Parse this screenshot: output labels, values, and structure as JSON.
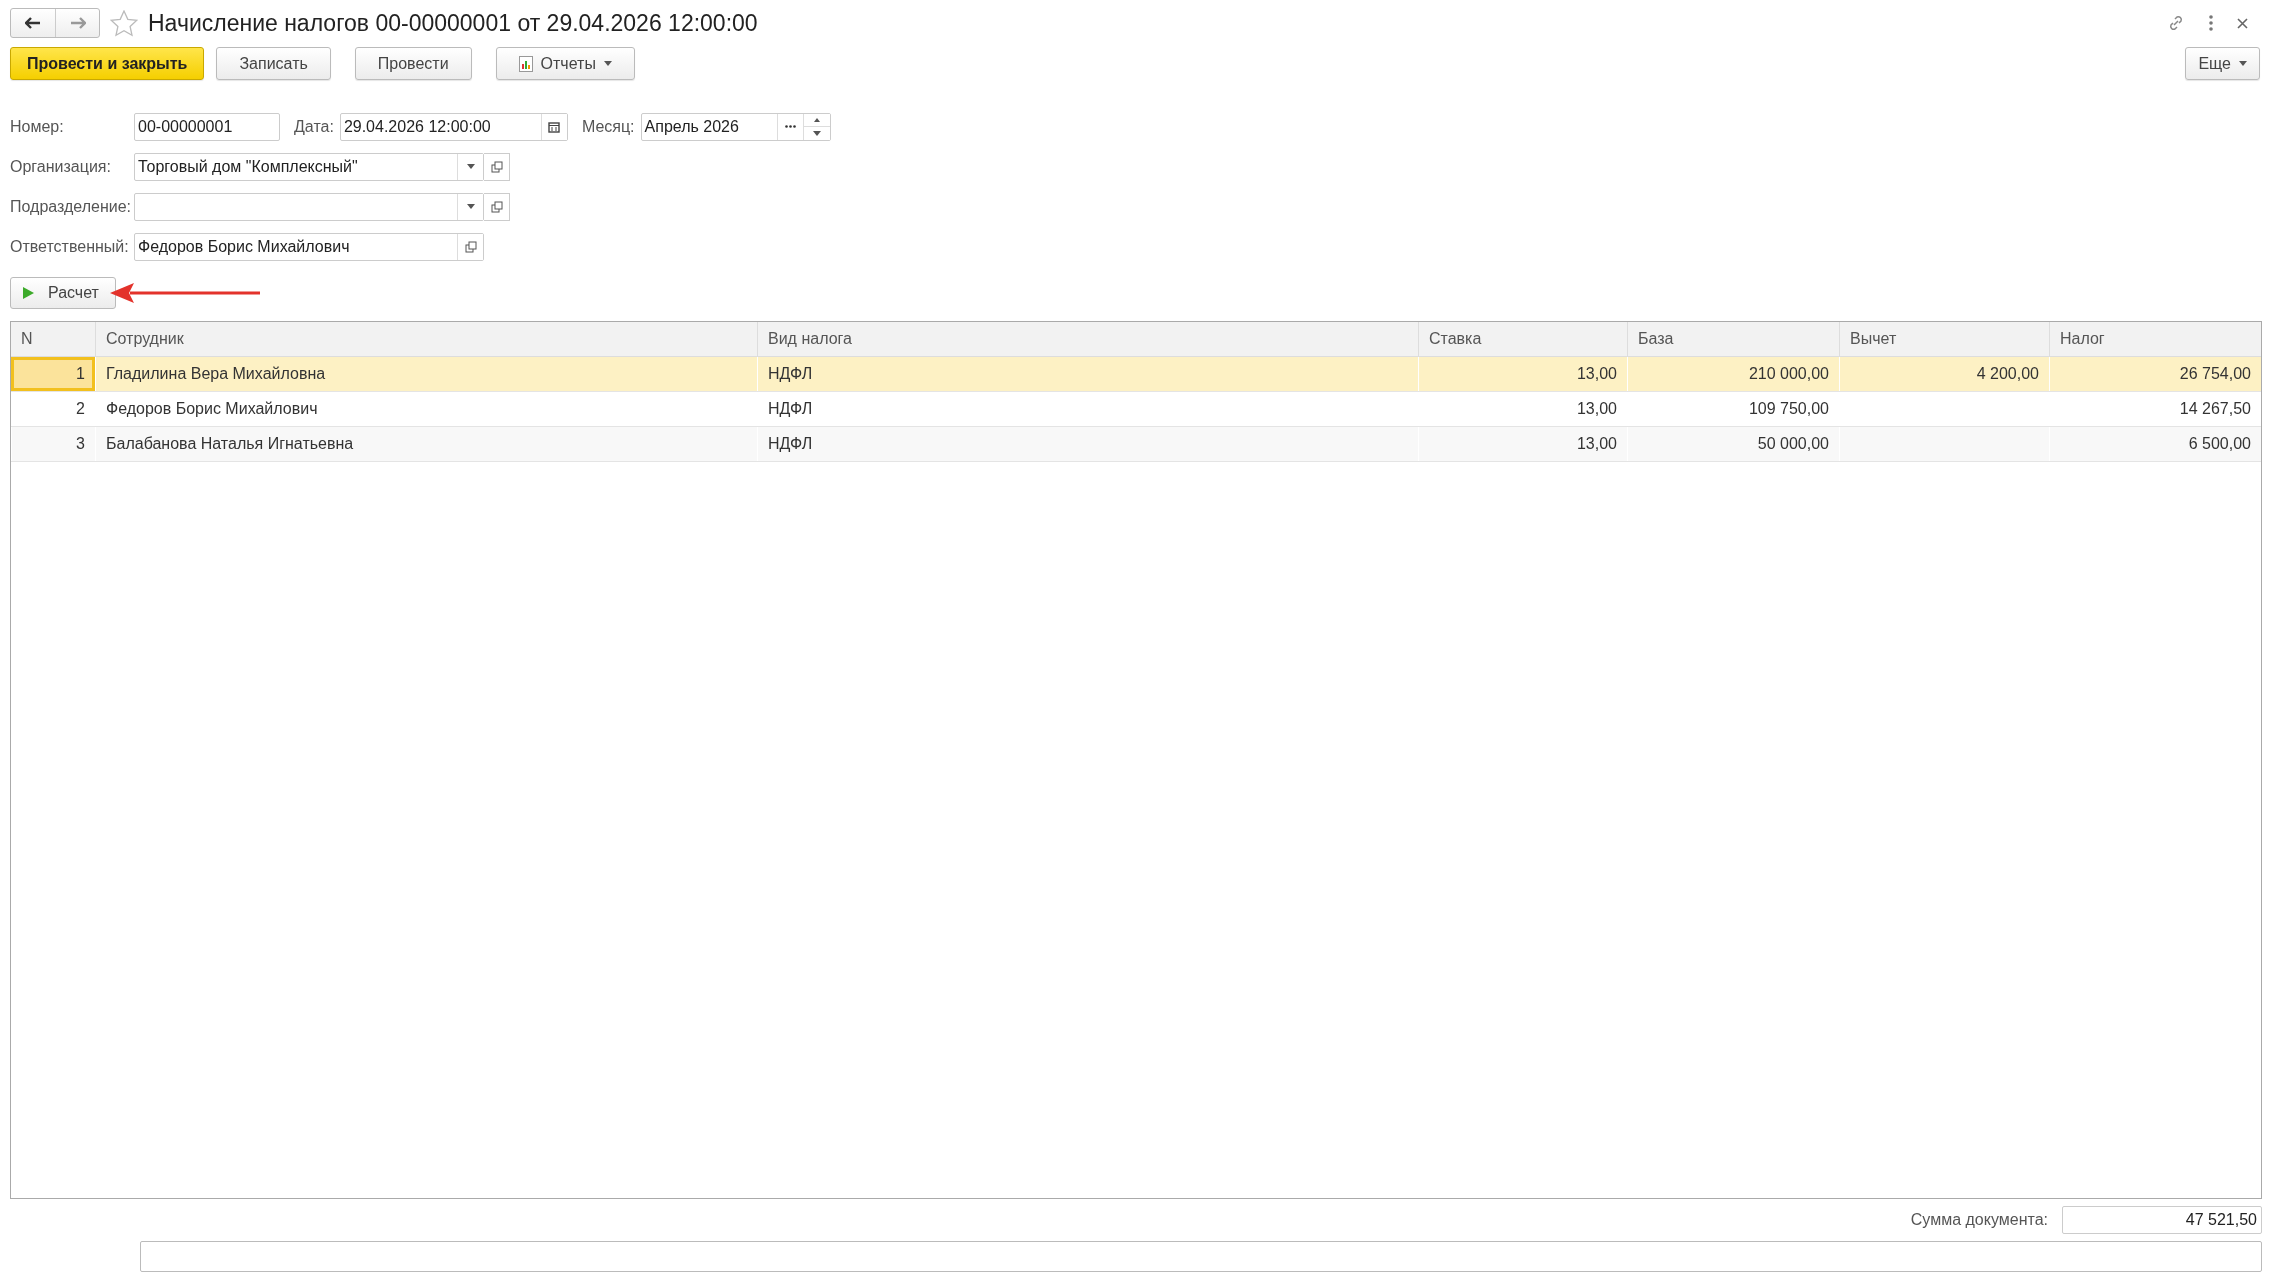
{
  "window": {
    "title": "Начисление налогов 00-00000001 от 29.04.2026 12:00:00"
  },
  "toolbar": {
    "buttons": [
      {
        "label": "Провести и закрыть",
        "kind": "primary"
      },
      {
        "label": "Записать",
        "kind": "plain"
      },
      {
        "label": "Провести",
        "kind": "plain"
      },
      {
        "label": "Отчеты",
        "kind": "menu"
      }
    ],
    "more": "Еще"
  },
  "header": {
    "number": {
      "label": "Номер:",
      "value": "00-00000001"
    },
    "date": {
      "label": "Дата:",
      "value": "29.04.2026 12:00:00"
    },
    "month": {
      "label": "Месяц:",
      "value": "Апрель 2026"
    }
  },
  "organization": {
    "label": "Организация:",
    "value": "Торговый дом \"Комплексный\""
  },
  "department": {
    "label": "Подразделение:"
  },
  "responsible": {
    "label": "Ответственный:",
    "value": "Федоров Борис Михайлович"
  },
  "calc_button": "Расчет",
  "table": {
    "columns": [
      "N",
      "Сотрудник",
      "Вид налога",
      "Ставка",
      "База",
      "Вычет",
      "Налог"
    ],
    "rows": [
      {
        "cells": [
          "1",
          "Гладилина Вера Михайловна",
          "НДФЛ",
          "13,00",
          "210 000,00",
          "4 200,00",
          "26 754,00"
        ],
        "selected": true
      },
      {
        "cells": [
          "2",
          "Федоров Борис Михайлович",
          "НДФЛ",
          "13,00",
          "109 750,00",
          "",
          "14 267,50"
        ],
        "selected": false
      },
      {
        "cells": [
          "3",
          "Балабанова Наталья Игнатьевна",
          "НДФЛ",
          "13,00",
          "50 000,00",
          "",
          "6 500,00"
        ],
        "selected": false
      }
    ]
  },
  "total": {
    "label": "Сумма документа:",
    "value": "47 521,50"
  }
}
